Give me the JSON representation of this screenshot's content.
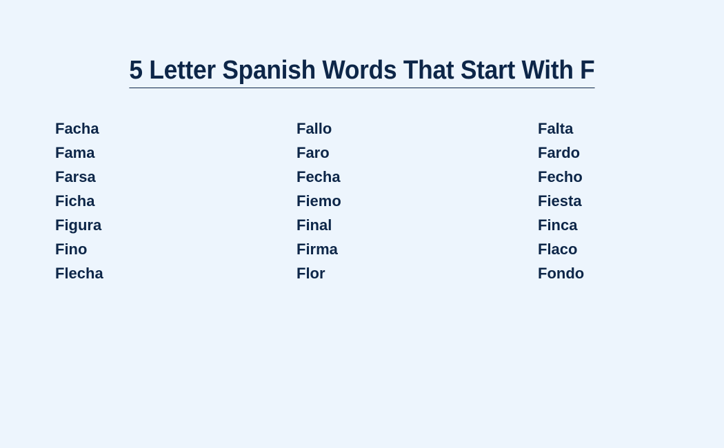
{
  "title": "5 Letter Spanish Words That Start With F",
  "words": [
    "Facha",
    "Fallo",
    "Falta",
    "Fama",
    "Faro",
    "Fardo",
    "Farsa",
    "Fecha",
    "Fecho",
    "Ficha",
    "Fiemo",
    "Fiesta",
    "Figura",
    "Final",
    "Finca",
    "Fino",
    "Firma",
    "Flaco",
    "Flecha",
    "Flor",
    "Fondo"
  ],
  "colors": {
    "background": "#edf5fd",
    "text": "#0d2648"
  }
}
